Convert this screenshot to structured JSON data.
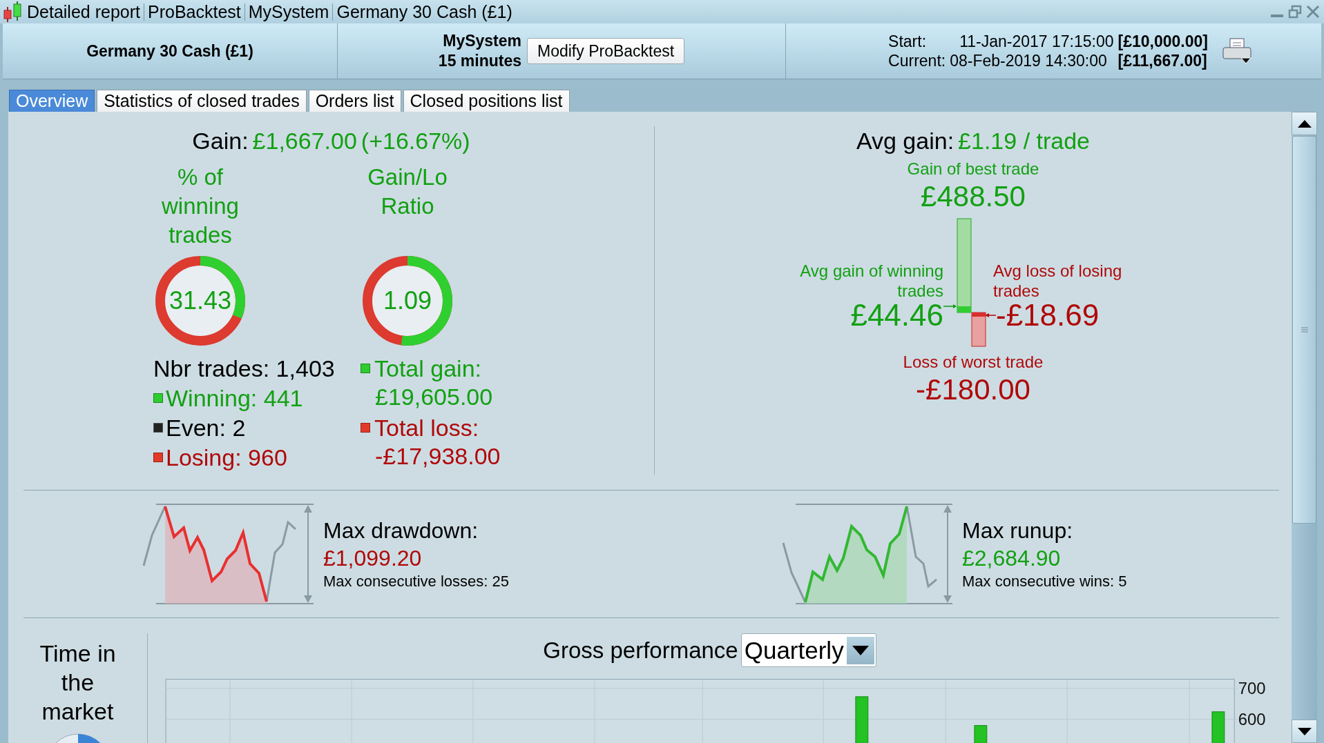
{
  "window": {
    "title_parts": [
      "Detailed report",
      "ProBacktest",
      "MySystem",
      "Germany 30 Cash (£1)"
    ]
  },
  "header": {
    "instrument": "Germany 30 Cash (£1)",
    "system": "MySystem",
    "timeframe": "15 minutes",
    "modify_button": "Modify ProBacktest",
    "start_label": "Start:",
    "start_date": "11-Jan-2017 17:15:00",
    "start_capital": "[£10,000.00]",
    "current_label": "Current:",
    "current_date": "08-Feb-2019 14:30:00",
    "current_capital": "[£11,667.00]"
  },
  "tabs": [
    {
      "label": "Overview",
      "selected": true
    },
    {
      "label": "Statistics of closed trades",
      "selected": false
    },
    {
      "label": "Orders list",
      "selected": false
    },
    {
      "label": "Closed positions list",
      "selected": false
    }
  ],
  "overview": {
    "gain": {
      "label": "Gain:",
      "value": "£1,667.00",
      "percent": "(+16.67%)"
    },
    "gauges": [
      {
        "title": "% of winning trades",
        "value": "31.43",
        "level": 0.3143
      },
      {
        "title": "Gain/Lo Ratio",
        "value": "1.09",
        "level": 0.522
      }
    ],
    "counts": [
      {
        "kind": "total",
        "text": "Nbr trades: 1,403"
      },
      {
        "kind": "winning",
        "text": "Winning: 441"
      },
      {
        "kind": "even",
        "text": "Even: 2"
      },
      {
        "kind": "losing",
        "text": "Losing: 960"
      }
    ],
    "totals": [
      {
        "kind": "gain",
        "label": "Total gain:",
        "value": "£19,605.00"
      },
      {
        "kind": "loss",
        "label": "Total loss:",
        "value": "-£17,938.00"
      }
    ],
    "avg_gain": {
      "label": "Avg gain:",
      "value": "£1.19 / trade"
    },
    "best_trade": {
      "label": "Gain of best trade",
      "value": "£488.50"
    },
    "avg_winning": {
      "label": "Avg gain of winning trades",
      "value": "£44.46"
    },
    "avg_losing": {
      "label": "Avg loss of losing trades",
      "value": "-£18.69"
    },
    "worst_trade": {
      "label": "Loss of worst trade",
      "value": "-£180.00"
    }
  },
  "extremes": [
    {
      "kind": "drawdown",
      "title": "Max drawdown:",
      "value": "£1,099.20",
      "detail": "Max consecutive losses: 25"
    },
    {
      "kind": "runup",
      "title": "Max runup:",
      "value": "£2,684.90",
      "detail": "Max consecutive wins: 5"
    }
  ],
  "time_in_market": {
    "title": "Time in the market"
  },
  "performance": {
    "title": "Gross performance",
    "period": "Quarterly",
    "axis_labels": [
      "700",
      "600"
    ]
  }
}
